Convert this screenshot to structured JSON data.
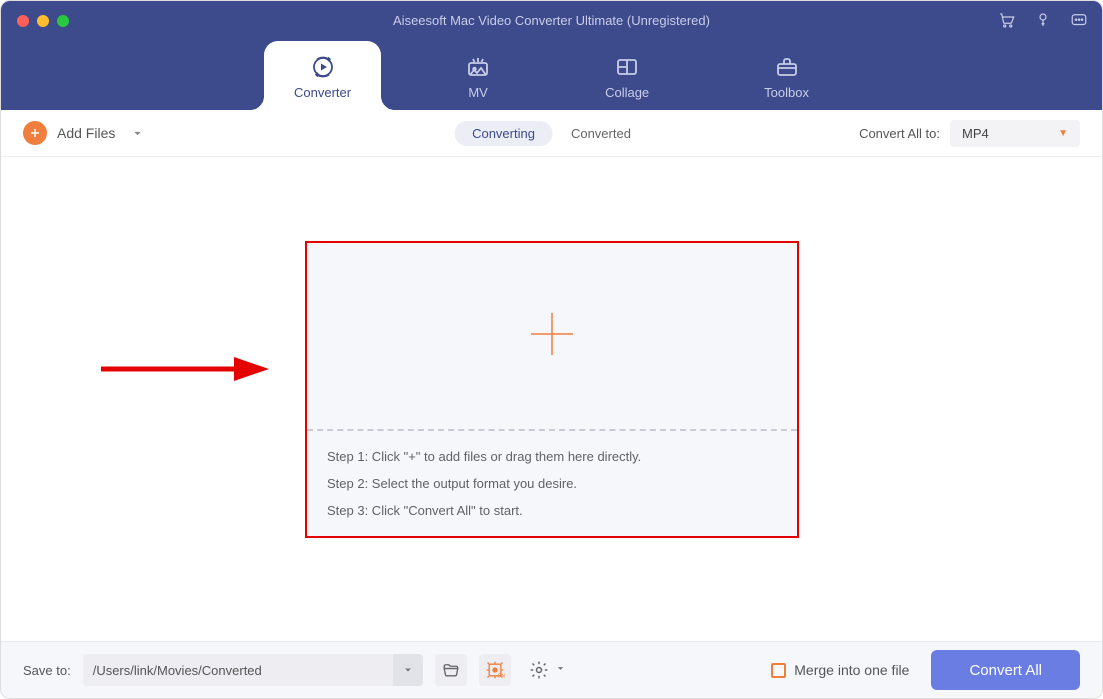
{
  "app": {
    "title": "Aiseesoft Mac Video Converter Ultimate (Unregistered)"
  },
  "tabs": {
    "converter": "Converter",
    "mv": "MV",
    "collage": "Collage",
    "toolbox": "Toolbox"
  },
  "toolbar": {
    "add_files": "Add Files",
    "converting": "Converting",
    "converted": "Converted",
    "convert_all_to_label": "Convert All to:",
    "format_selected": "MP4"
  },
  "dropzone": {
    "step1": "Step 1: Click \"+\" to add files or drag them here directly.",
    "step2": "Step 2: Select the output format you desire.",
    "step3": "Step 3: Click \"Convert All\" to start."
  },
  "footer": {
    "save_to_label": "Save to:",
    "save_path": "/Users/link/Movies/Converted",
    "merge_label": "Merge into one file",
    "convert_all_btn": "Convert All"
  }
}
